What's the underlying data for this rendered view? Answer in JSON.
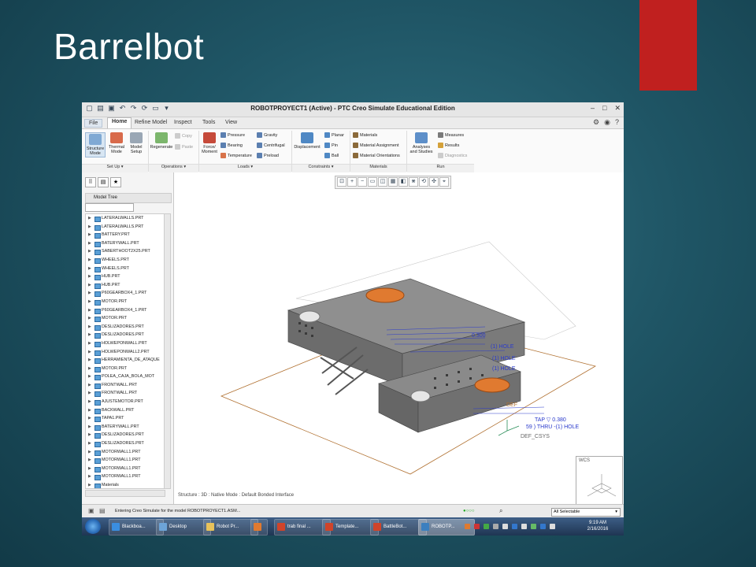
{
  "slide": {
    "title": "Barrelbot"
  },
  "window": {
    "title": "ROBOTPROYECT1 (Active) - PTC Creo Simulate Educational Edition",
    "tabs": [
      "File",
      "Home",
      "Refine Model",
      "Inspect",
      "Tools",
      "View"
    ],
    "active_tab": "Home"
  },
  "ribbon": {
    "structure_mode": "Structure\nMode",
    "thermal_mode": "Thermal\nMode",
    "model_setup": "Model\nSetup",
    "regenerate": "Regenerate",
    "copy": "Copy",
    "paste": "Paste",
    "force_moment": "Force/\nMoment",
    "pressure": "Pressure",
    "bearing": "Bearing",
    "temperature": "Temperature",
    "gravity": "Gravity",
    "centrifugal": "Centrifugal",
    "preload": "Preload",
    "displacement": "Displacement",
    "planar": "Planar",
    "pin": "Pin",
    "ball": "Ball",
    "materials": "Materials",
    "material_assignment": "Material Assignment",
    "material_orientations": "Material Orientations",
    "analyses": "Analyses\nand Studies",
    "measures": "Measures",
    "results": "Results",
    "diagnostics": "Diagnostics",
    "groups": {
      "setup": "Set Up ▾",
      "operations": "Operations ▾",
      "loads": "Loads ▾",
      "constraints": "Constraints ▾",
      "materials": "Materials",
      "run": "Run"
    }
  },
  "model_tree": {
    "header": "Model Tree",
    "items": [
      "LATERALWALLS.PRT",
      "LATERALWALLS.PRT",
      "BATTERY.PRT",
      "BATERYWALL.PRT",
      "SABERTHOOT2X25.PRT",
      "WHEELS.PRT",
      "WHEELS.PRT",
      "HUB.PRT",
      "HUB.PRT",
      "P60GEARBOX4_1.PRT",
      "MOTOR.PRT",
      "P60GEARBOX4_1.PRT",
      "MOTOR.PRT",
      "DESLIZADORES.PRT",
      "DESLIZADORES.PRT",
      "HOLWEPONWALL.PRT",
      "HOLWEPONWALL2.PRT",
      "HERRAMIENTA_DE_ATAQUE",
      "MOTOR.PRT",
      "POLEA_CAJA_BOLA_MOT",
      "FRONTWALL.PRT",
      "FRONTWALL.PRT",
      "AJUSTEMOTOR.PRT",
      "BACKWALL.PRT",
      "TAPA1.PRT",
      "BATERYWALL.PRT",
      "DESLIZADORES.PRT",
      "DESLIZADORES.PRT",
      "MOTORWALL1.PRT",
      "MOTORWALL1.PRT",
      "MOTORWALL1.PRT",
      "MOTORWALL1.PRT",
      "Materials"
    ]
  },
  "graphics": {
    "annotations": [
      "(1) HOLE",
      "0.300",
      "(1) HOLE",
      "(1) HOLE",
      "DEF",
      "TAP ▽ 0.380",
      "59 ) THRU -(1) HOLE",
      "DEF_CSYS"
    ],
    "status": "Structure : 3D : Native Mode : Default Bonded Interface",
    "wcs_label": "WCS"
  },
  "message_bar": {
    "message": "Entering Creo Simulate for the model ROBOTPROYECT1.ASM...",
    "filter": "All Selectable"
  },
  "taskbar": {
    "buttons": [
      "Blackboa...",
      "Desktop",
      "Robot Pr...",
      "",
      "trab final ...",
      "Template...",
      "BattleBot...",
      "ROBOTP..."
    ],
    "time": "9:19 AM",
    "date": "2/16/2016"
  },
  "colors": {
    "accent_red": "#c0201f",
    "background": "#1f5565"
  }
}
